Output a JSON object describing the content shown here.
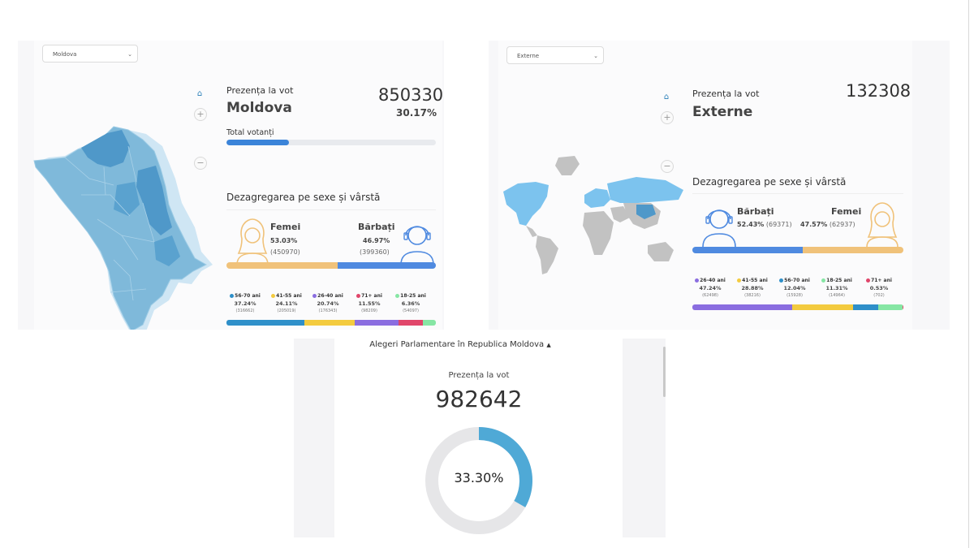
{
  "moldova": {
    "select_value": "Moldova",
    "turnout_label": "Prezența la vot",
    "region": "Moldova",
    "count": "850330",
    "percent": "30.17%",
    "total_label": "Total votanți",
    "total_fill": 0.3,
    "breakdown_title": "Dezagregarea pe sexe și vârstă",
    "women": {
      "label": "Femei",
      "percent": "53.03%",
      "count": "(450970)",
      "share": 0.5303
    },
    "men": {
      "label": "Bărbați",
      "percent": "46.97%",
      "count": "(399360)",
      "share": 0.4697
    },
    "ages": [
      {
        "name": "56-70 ani",
        "percent": "37.24%",
        "count": "(316662)",
        "color": "#2e8fc9",
        "share": 0.3724
      },
      {
        "name": "41-55 ani",
        "percent": "24.11%",
        "count": "(205019)",
        "color": "#f3cb3f",
        "share": 0.2411
      },
      {
        "name": "26-40 ani",
        "percent": "20.74%",
        "count": "(176343)",
        "color": "#8a6de0",
        "share": 0.2074
      },
      {
        "name": "71+ ani",
        "percent": "11.55%",
        "count": "(98209)",
        "color": "#e0456a",
        "share": 0.1155
      },
      {
        "name": "18-25 ani",
        "percent": "6.36%",
        "count": "(54097)",
        "color": "#86e6a4",
        "share": 0.0636
      }
    ]
  },
  "externe": {
    "select_value": "Externe",
    "turnout_label": "Prezența la vot",
    "region": "Externe",
    "count": "132308",
    "breakdown_title": "Dezagregarea pe sexe și vârstă",
    "men": {
      "label": "Bărbați",
      "percent": "52.43%",
      "count": "(69371)",
      "share": 0.5243
    },
    "women": {
      "label": "Femei",
      "percent": "47.57%",
      "count": "(62937)",
      "share": 0.4757
    },
    "ages": [
      {
        "name": "26-40 ani",
        "percent": "47.24%",
        "count": "(62498)",
        "color": "#8a6de0",
        "share": 0.4724
      },
      {
        "name": "41-55 ani",
        "percent": "28.88%",
        "count": "(38216)",
        "color": "#f3cb3f",
        "share": 0.2888
      },
      {
        "name": "56-70 ani",
        "percent": "12.04%",
        "count": "(15928)",
        "color": "#2e8fc9",
        "share": 0.1204
      },
      {
        "name": "18-25 ani",
        "percent": "11.31%",
        "count": "(14964)",
        "color": "#86e6a4",
        "share": 0.1131
      },
      {
        "name": "71+ ani",
        "percent": "0.53%",
        "count": "(702)",
        "color": "#e0456a",
        "share": 0.0053
      }
    ]
  },
  "summary": {
    "title": "Alegeri Parlamentare în Republica Moldova",
    "title_icon": "caret-up-icon",
    "turnout_label": "Prezența la vot",
    "count": "982642",
    "percent": "33.30%",
    "fraction": 0.333
  },
  "colors": {
    "accent": "#3b84d9",
    "women": "#f0c27a",
    "men": "#4f8ae0",
    "donut": "#4fa9d6",
    "donut_track": "#e6e6e8",
    "map_land": "#7fb9da",
    "map_dark": "#4f98c9",
    "world_grey": "#c2c2c2",
    "world_blue": "#7cc3ee"
  },
  "icons": {
    "home": "home-icon",
    "zoom_in": "plus-icon",
    "zoom_out": "minus-icon",
    "select": "chevron-down-icon"
  }
}
